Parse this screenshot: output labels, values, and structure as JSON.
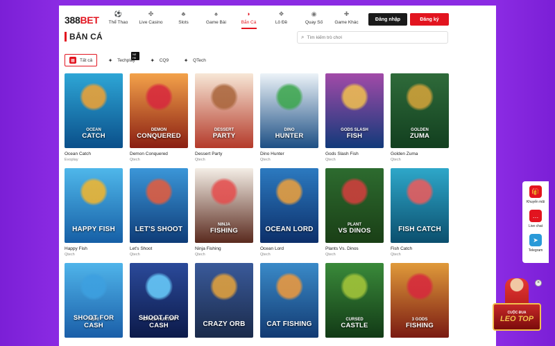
{
  "logo": {
    "prefix": "388",
    "suffix": "BET"
  },
  "nav": [
    {
      "label": "Thể Thao",
      "icon": "soccer-ball-icon",
      "glyph": "⚽",
      "active": false
    },
    {
      "label": "Live Casino",
      "icon": "casino-chip-icon",
      "glyph": "✤",
      "active": false
    },
    {
      "label": "Slots",
      "icon": "slot-machine-icon",
      "glyph": "♣",
      "active": false
    },
    {
      "label": "Game Bài",
      "icon": "playing-cards-icon",
      "glyph": "♠",
      "active": false
    },
    {
      "label": "Bắn Cá",
      "icon": "fish-icon",
      "glyph": "◗",
      "active": true
    },
    {
      "label": "Lô Đề",
      "icon": "lottery-ball-icon",
      "glyph": "❖",
      "active": false
    },
    {
      "label": "Quay Số",
      "icon": "lucky-draw-icon",
      "glyph": "◉",
      "active": false
    },
    {
      "label": "Game Khác",
      "icon": "gamepad-icon",
      "glyph": "✚",
      "active": false
    }
  ],
  "auth": {
    "login": "Đăng nhập",
    "register": "Đăng ký"
  },
  "page_title": "BẮN CÁ",
  "search": {
    "placeholder": "Tìm kiếm trò chơi"
  },
  "filters": [
    {
      "label": "Tất cả",
      "active": true,
      "icon": "all-games-icon"
    },
    {
      "label": "Techplay",
      "active": false,
      "icon": "techplay-logo-icon",
      "badge": "Nổ Hũ"
    },
    {
      "label": "CQ9",
      "active": false,
      "icon": "cq9-logo-icon"
    },
    {
      "label": "QTech",
      "active": false,
      "icon": "qtech-logo-icon"
    }
  ],
  "games": [
    {
      "name": "Ocean Catch",
      "provider": "Evoplay",
      "line1": "OCEAN",
      "line2": "CATCH",
      "bg": [
        "#2ea6d6",
        "#0a4f8a"
      ],
      "art": "#f4a230"
    },
    {
      "name": "Demon Conquered",
      "provider": "Qtech",
      "line1": "DEMON",
      "line2": "CONQUERED",
      "bg": [
        "#f3a24a",
        "#8a1e12"
      ],
      "art": "#d7263d"
    },
    {
      "name": "Dessert Party",
      "provider": "Qtech",
      "line1": "DESSERT",
      "line2": "PARTY",
      "bg": [
        "#f7e7d6",
        "#b43a2a"
      ],
      "art": "#a8643a"
    },
    {
      "name": "Dino Hunter",
      "provider": "Qtech",
      "line1": "DINO",
      "line2": "HUNTER",
      "bg": [
        "#ecf3f8",
        "#1d4f84"
      ],
      "art": "#3aa64a"
    },
    {
      "name": "Gods Slash Fish",
      "provider": "Qtech",
      "line1": "GODS SLASH",
      "line2": "FISH",
      "bg": [
        "#a24aa8",
        "#123a7a"
      ],
      "art": "#f2c14e"
    },
    {
      "name": "Golden Zuma",
      "provider": "Qtech",
      "line1": "GOLDEN",
      "line2": "ZUMA",
      "bg": [
        "#2f6b3a",
        "#123f1f"
      ],
      "art": "#d8a43a"
    },
    {
      "name": "Happy Fish",
      "provider": "Qtech",
      "line1": "",
      "line2": "HAPPY FISH",
      "bg": [
        "#4fb7ea",
        "#165fa6"
      ],
      "art": "#f6b62a"
    },
    {
      "name": "Let's Shoot",
      "provider": "Qtech",
      "line1": "",
      "line2": "LET'S SHOOT",
      "bg": [
        "#3b96d8",
        "#0e3c78"
      ],
      "art": "#e85b3a"
    },
    {
      "name": "Ninja Fishing",
      "provider": "Qtech",
      "line1": "NINJA",
      "line2": "FISHING",
      "bg": [
        "#f4eee6",
        "#5a2a1e"
      ],
      "art": "#e54b4b"
    },
    {
      "name": "Ocean Lord",
      "provider": "Qtech",
      "line1": "",
      "line2": "OCEAN LORD",
      "bg": [
        "#2c7ac0",
        "#0c2f6a"
      ],
      "art": "#f0a13a"
    },
    {
      "name": "Plants Vs. Dinos",
      "provider": "Qtech",
      "line1": "PLANT",
      "line2": "VS DINOS",
      "bg": [
        "#2d6b2f",
        "#1a3f16"
      ],
      "art": "#d73d3d"
    },
    {
      "name": "Fish Catch",
      "provider": "Qtech",
      "line1": "",
      "line2": "FISH CATCH",
      "bg": [
        "#2ea7c9",
        "#0b4f6e"
      ],
      "art": "#f05a5a"
    },
    {
      "name": "",
      "provider": "",
      "line1": "FISH!",
      "line2": "SHOOT FOR CASH",
      "bg": [
        "#4fb4ea",
        "#1a5ea8"
      ],
      "art": "#3da0e0"
    },
    {
      "name": "",
      "provider": "",
      "line1": "SPACE HUNTER",
      "line2": "SHOOT FOR CASH",
      "bg": [
        "#2b4a9a",
        "#0c1a4a"
      ],
      "art": "#6ad0ff"
    },
    {
      "name": "",
      "provider": "",
      "line1": "",
      "line2": "CRAZY ORB",
      "bg": [
        "#3a5a9a",
        "#1a2a4a"
      ],
      "art": "#e8a43a"
    },
    {
      "name": "",
      "provider": "",
      "line1": "",
      "line2": "CAT FISHING",
      "bg": [
        "#3a8ac8",
        "#123a72"
      ],
      "art": "#f29a3a"
    },
    {
      "name": "",
      "provider": "",
      "line1": "CURSED",
      "line2": "CASTLE",
      "bg": [
        "#3a8a3a",
        "#123a16"
      ],
      "art": "#a8c83a"
    },
    {
      "name": "",
      "provider": "",
      "line1": "3 GODS",
      "line2": "FISHING",
      "bg": [
        "#e09a3a",
        "#7a1a12"
      ],
      "art": "#d7263d"
    }
  ],
  "side": [
    {
      "label": "Khuyến mãi",
      "icon": "gift-icon",
      "glyph": "🎁",
      "color": "#e2141f"
    },
    {
      "label": "Live chat",
      "icon": "chat-icon",
      "glyph": "…",
      "color": "#e2141f"
    },
    {
      "label": "Telegram",
      "icon": "telegram-icon",
      "glyph": "➤",
      "color": "#2a9ad8"
    }
  ],
  "promo": {
    "line1": "CUỘC ĐUA",
    "line2": "LEO TOP"
  }
}
